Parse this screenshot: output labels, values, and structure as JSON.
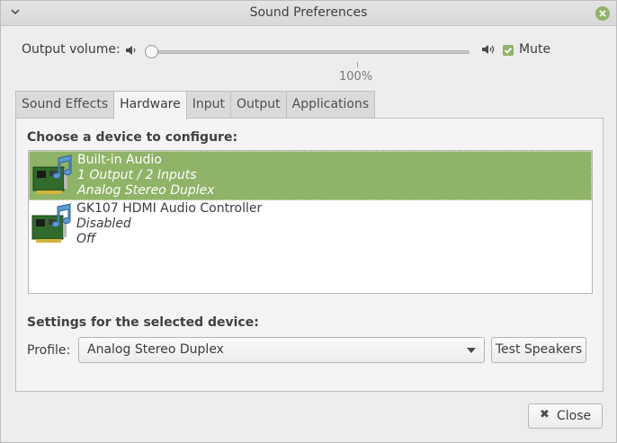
{
  "window": {
    "title": "Sound Preferences",
    "menu_icon": "chevron-down-icon",
    "close_icon": "close-icon",
    "accent_color": "#8fb367"
  },
  "volume": {
    "label": "Output volume:",
    "low_icon": "speaker-low-icon",
    "high_icon": "speaker-high-icon",
    "level_percent": 0,
    "tick_label": "100%",
    "mute_label": "Mute",
    "mute_checked": true
  },
  "tabs": [
    {
      "label": "Sound Effects",
      "active": false
    },
    {
      "label": "Hardware",
      "active": true
    },
    {
      "label": "Input",
      "active": false
    },
    {
      "label": "Output",
      "active": false
    },
    {
      "label": "Applications",
      "active": false
    }
  ],
  "hardware": {
    "choose_title": "Choose a device to configure:",
    "devices": [
      {
        "name": "Built-in Audio",
        "line2": "1 Output / 2 Inputs",
        "line3": "Analog Stereo Duplex",
        "selected": true,
        "icon": "sound-card-icon"
      },
      {
        "name": "GK107 HDMI Audio Controller",
        "line2": "Disabled",
        "line3": "Off",
        "selected": false,
        "icon": "sound-card-icon"
      }
    ],
    "settings_title": "Settings for the selected device:",
    "profile_label": "Profile:",
    "profile_value": "Analog Stereo Duplex",
    "test_button": "Test Speakers"
  },
  "footer": {
    "close_label": "Close",
    "close_icon": "close-x-icon"
  }
}
